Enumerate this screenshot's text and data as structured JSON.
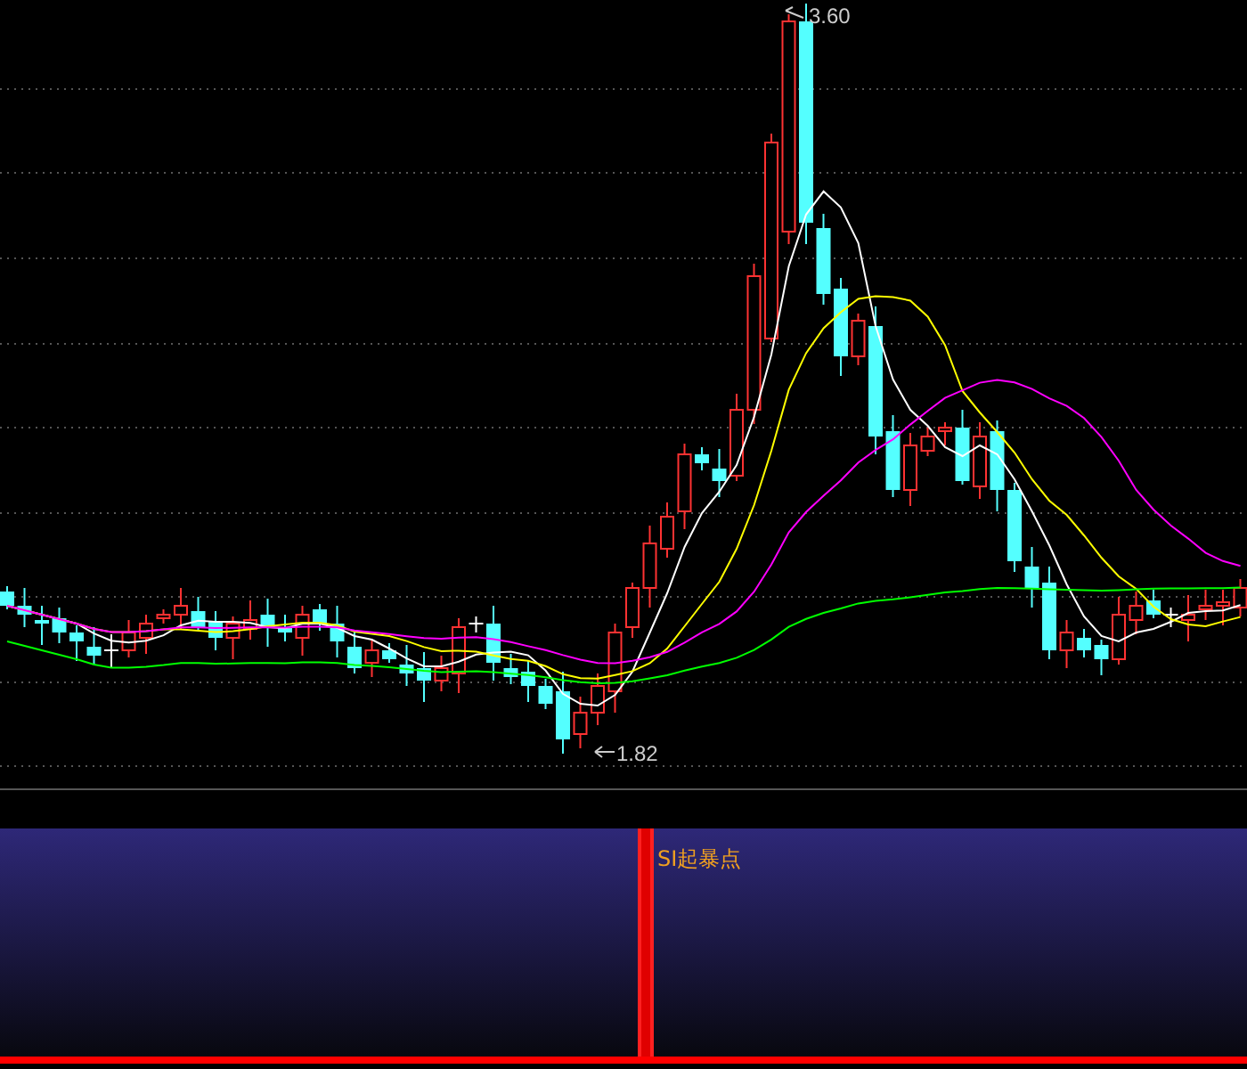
{
  "price_chart": {
    "high_label": "3.60",
    "low_label": "1.82"
  },
  "indicator_panel": {
    "title": "SI起暴点"
  }
}
